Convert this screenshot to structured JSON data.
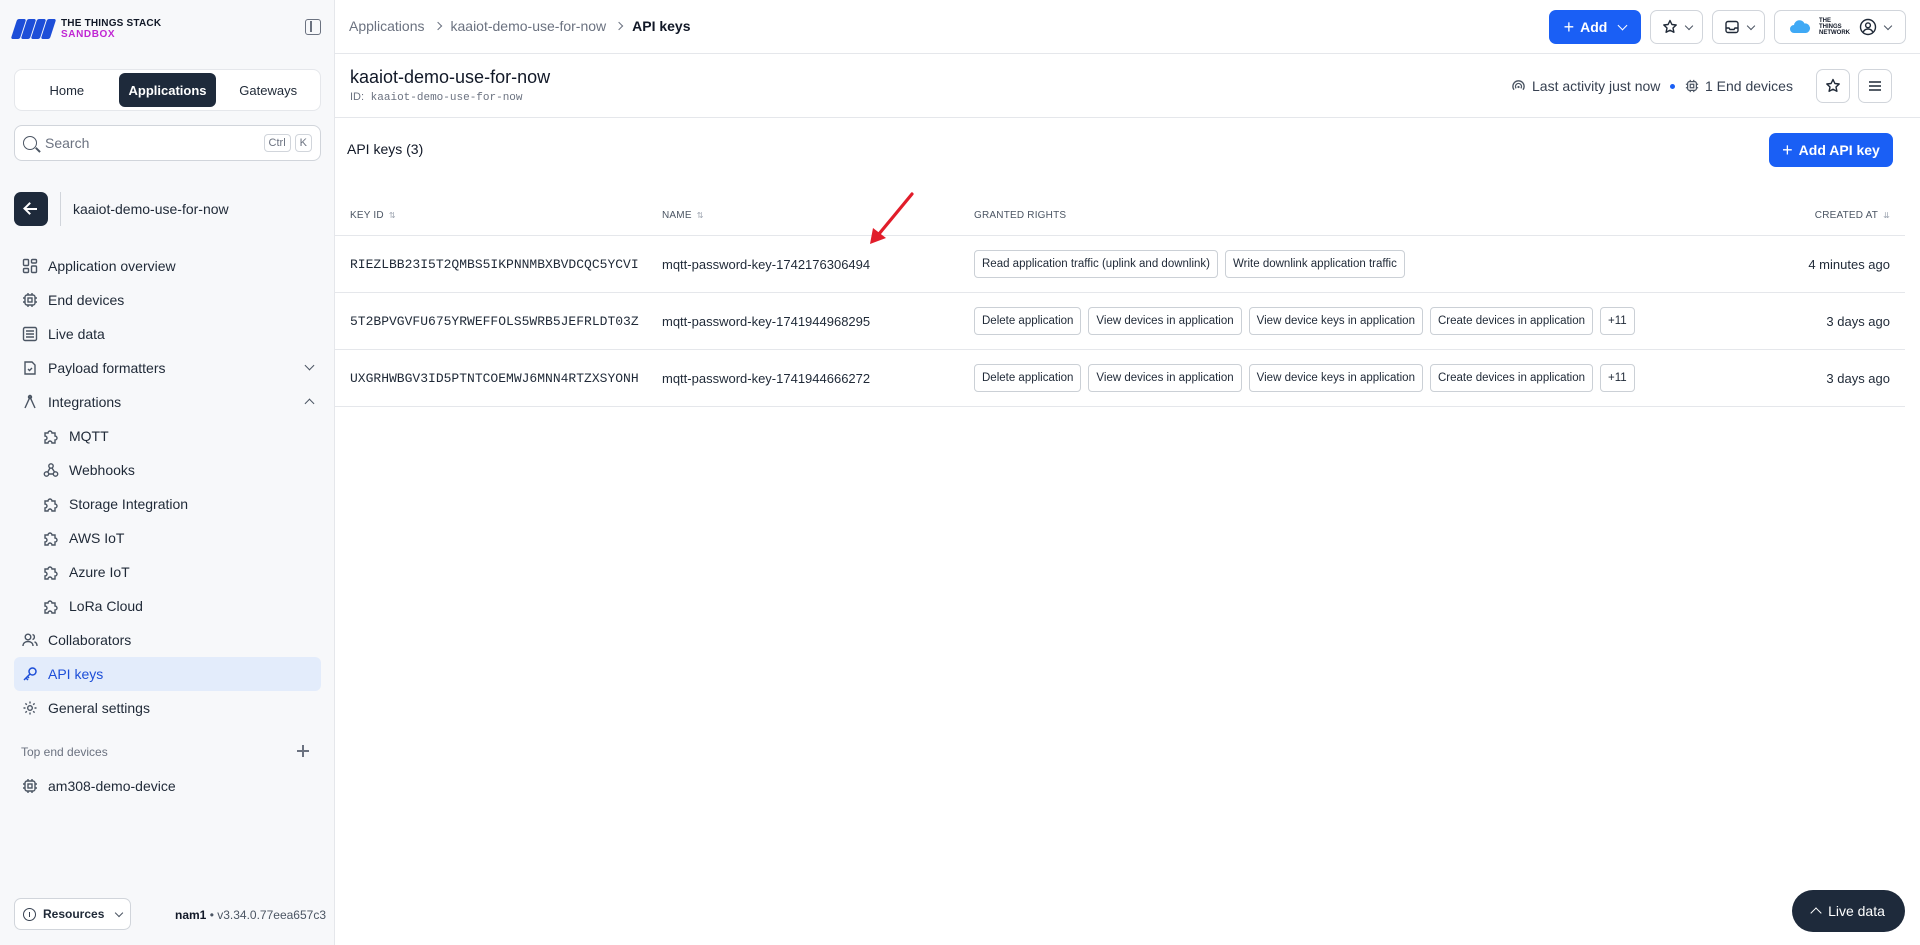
{
  "brand": {
    "line1": "THE THINGS STACK",
    "line2": "SANDBOX"
  },
  "segmented": [
    {
      "label": "Home",
      "active": false
    },
    {
      "label": "Applications",
      "active": true
    },
    {
      "label": "Gateways",
      "active": false
    }
  ],
  "search": {
    "placeholder": "Search",
    "kbd1": "Ctrl",
    "kbd2": "K"
  },
  "app": {
    "name": "kaaiot-demo-use-for-now",
    "id_label": "ID:",
    "id": "kaaiot-demo-use-for-now"
  },
  "nav": {
    "overview": "Application overview",
    "end_devices": "End devices",
    "live_data": "Live data",
    "payload_formatters": "Payload formatters",
    "integrations": "Integrations",
    "mqtt": "MQTT",
    "webhooks": "Webhooks",
    "storage": "Storage Integration",
    "aws": "AWS IoT",
    "azure": "Azure IoT",
    "lora": "LoRa Cloud",
    "collaborators": "Collaborators",
    "api_keys": "API keys",
    "general": "General settings"
  },
  "top_devices": {
    "title": "Top end devices",
    "items": [
      "am308-demo-device"
    ]
  },
  "footer": {
    "resources": "Resources",
    "cluster": "nam1",
    "version": " • v3.34.0.77eea657c3"
  },
  "breadcrumb": {
    "c1": "Applications",
    "c2": "kaaiot-demo-use-for-now",
    "c3": "API keys"
  },
  "topbar": {
    "add_label": "Add",
    "network_label": "THE THINGS NETWORK"
  },
  "appbar": {
    "activity": "Last activity just now",
    "devices": "1 End devices"
  },
  "content": {
    "heading": "API keys (3)",
    "add_key": "Add API key"
  },
  "table": {
    "headers": {
      "key_id": "KEY ID",
      "name": "NAME",
      "rights": "GRANTED RIGHTS",
      "created": "CREATED AT"
    },
    "rows": [
      {
        "key_id": "RIEZLBB23I5T2QMBS5IKPNNMBXBVDCQC5YCVI",
        "name": "mqtt-password-key-1742176306494",
        "rights": [
          "Read application traffic (uplink and downlink)",
          "Write downlink application traffic"
        ],
        "created": "4 minutes ago"
      },
      {
        "key_id": "5T2BPVGVFU675YRWEFFOLS5WRB5JEFRLDT03Z",
        "name": "mqtt-password-key-1741944968295",
        "rights": [
          "Delete application",
          "View devices in application",
          "View device keys in application",
          "Create devices in application",
          "+11"
        ],
        "created": "3 days ago"
      },
      {
        "key_id": "UXGRHWBGV3ID5PTNTCOEMWJ6MNN4RTZXSYONH",
        "name": "mqtt-password-key-1741944666272",
        "rights": [
          "Delete application",
          "View devices in application",
          "View device keys in application",
          "Create devices in application",
          "+11"
        ],
        "created": "3 days ago"
      }
    ]
  },
  "live_button": "Live data",
  "colors": {
    "primary": "#1a5ff5",
    "dark": "#1e2a3b",
    "active_bg": "#e3ecfb",
    "annotation": "#e11d2a"
  }
}
